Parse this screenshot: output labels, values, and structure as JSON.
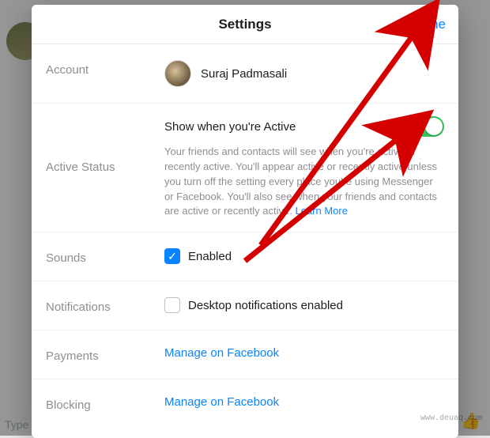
{
  "header": {
    "title": "Settings",
    "done_label": "Done"
  },
  "account": {
    "label": "Account",
    "user_name": "Suraj Padmasali"
  },
  "active_status": {
    "label": "Active Status",
    "title": "Show when you're Active",
    "toggle_on": true,
    "description_pre": "Your friends and contacts will see when you're active or recently active. You'll appear active or recently active unless you turn off the setting every place you're using Messenger or Facebook. You'll also see when your friends and contacts are active or recently active. ",
    "learn_more": "Learn More"
  },
  "sounds": {
    "label": "Sounds",
    "checked": true,
    "enabled_label": "Enabled"
  },
  "notifications": {
    "label": "Notifications",
    "checked": false,
    "desktop_label": "Desktop notifications enabled"
  },
  "payments": {
    "label": "Payments",
    "link": "Manage on Facebook"
  },
  "blocking": {
    "label": "Blocking",
    "link": "Manage on Facebook"
  },
  "background": {
    "type_placeholder": "Type"
  },
  "watermark": "www.deuaq.com",
  "colors": {
    "accent": "#0a84ff",
    "toggle_green": "#34c759",
    "arrow_red": "#d40000"
  }
}
